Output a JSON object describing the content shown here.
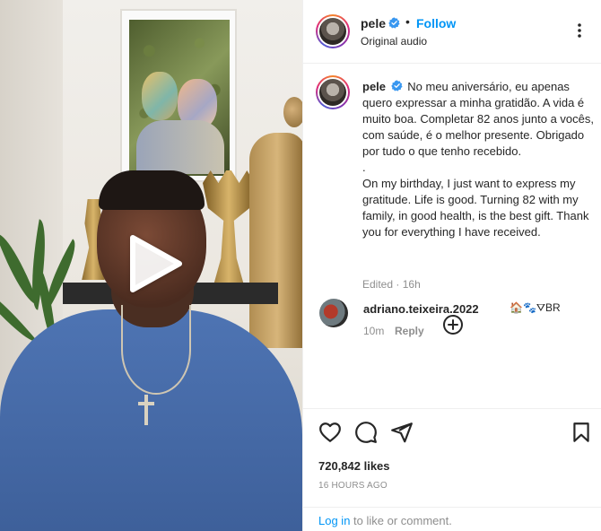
{
  "post": {
    "username": "pele",
    "follow_label": "Follow",
    "audio_label": "Original audio",
    "separator": "•"
  },
  "caption": {
    "username": "pele",
    "pt_text": "No meu aniversário, eu apenas quero expressar a minha gratidão. A vida é muito boa. Completar 82 anos junto a vocês, com saúde, é o melhor presente. Obrigado por tudo o que tenho recebido.",
    "dot": ".",
    "en_text": "On my birthday, I just want to express my gratitude. Life is good. Turning 82 with my family, in good health, is the best gift. Thank you for everything I have received.",
    "edited_label": "Edited",
    "meta_sep": "·",
    "time": "16h"
  },
  "comment": {
    "username": "adriano.teixeira.2022",
    "emoji": "🏠🐾⛛BR",
    "time": "10m",
    "reply_label": "Reply"
  },
  "engagement": {
    "likes": "720,842 likes",
    "time_ago": "16 HOURS AGO"
  },
  "login": {
    "link_label": "Log in",
    "suffix": " to like or comment."
  },
  "icons": {
    "play": "play-icon",
    "more": "more-options-icon",
    "verified": "verified-badge-icon",
    "add": "add-circle-icon",
    "like": "heart-icon",
    "comment": "comment-bubble-icon",
    "share": "paper-plane-icon",
    "save": "bookmark-icon"
  },
  "colors": {
    "accent": "#0095f6",
    "verified": "#3897f0",
    "text": "#262626",
    "muted": "#8e8e8e"
  }
}
